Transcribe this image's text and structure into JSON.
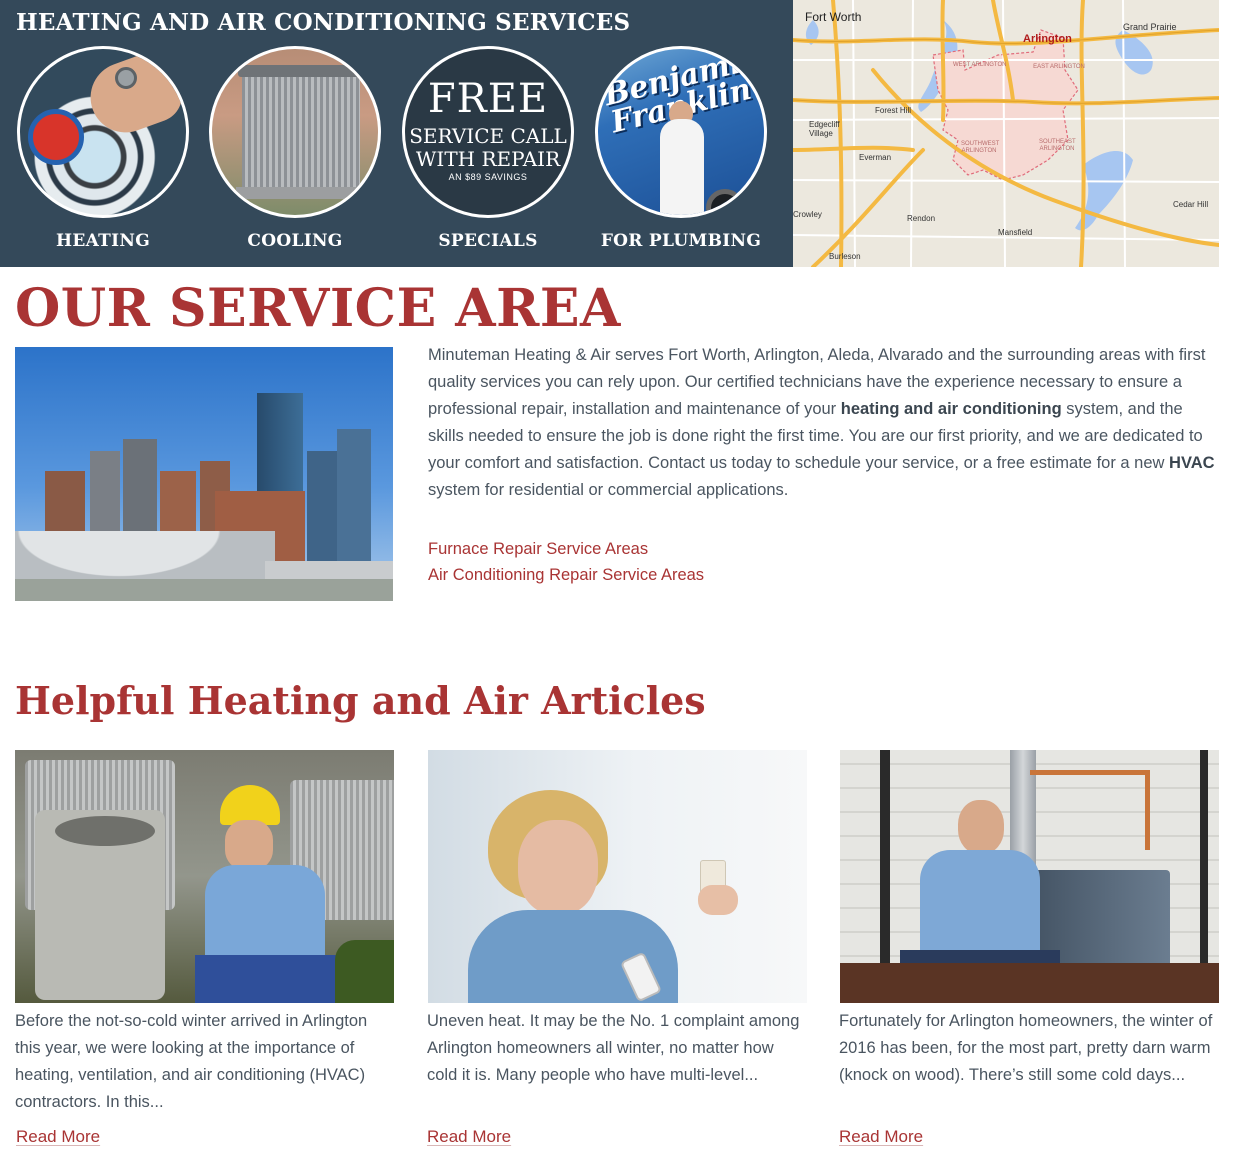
{
  "banner": {
    "title": "HEATING AND AIR CONDITIONING SERVICES",
    "services": [
      {
        "label": "HEATING"
      },
      {
        "label": "COOLING"
      },
      {
        "label": "SPECIALS"
      },
      {
        "label": "FOR PLUMBING"
      }
    ],
    "specials_badge": {
      "free": "FREE",
      "line1": "SERVICE CALL",
      "line2": "WITH REPAIR",
      "savings": "AN $89 SAVINGS"
    },
    "plumbing_brand": "Benjamin Franklin"
  },
  "map": {
    "labels": {
      "fort_worth": "Fort Worth",
      "arlington": "Arlington",
      "grand_prairie": "Grand Prairie",
      "forest_hill": "Forest Hill",
      "edgecliff": "Edgecliff Village",
      "everman": "Everman",
      "rendon": "Rendon",
      "mansfield": "Mansfield",
      "crowley": "Crowley",
      "burleson": "Burleson",
      "cedar_hill": "Cedar Hill",
      "west_arlington": "WEST ARLINGTON",
      "east_arlington": "EAST ARLINGTON",
      "southwest_arlington": "SOUTHWEST ARLINGTON",
      "southeast_arlington": "SOUTHEAST ARLINGTON"
    },
    "colors": {
      "highway": "#f4b942",
      "road": "#ffffff",
      "water": "#a7c6f1",
      "boundary": "#e06b7a",
      "area_fill": "#f6d9d3"
    }
  },
  "service_area": {
    "heading": "OUR SERVICE AREA",
    "paragraph_part1": "Minuteman Heating & Air serves Fort Worth, Arlington, Aleda, Alvarado and the surrounding areas with first quality services you can rely upon. Our certified technicians have the experience necessary to ensure a professional repair, installation and maintenance of your ",
    "paragraph_bold1": "heating and air conditioning",
    "paragraph_part2": " system, and the skills needed to ensure the job is done right the first time. You are our first priority, and we are dedicated to your comfort and satisfaction. Contact us today to schedule your service, or a free estimate for a new ",
    "paragraph_bold2": "HVAC",
    "paragraph_part3": " system for residential or commercial applications.",
    "links": [
      "Furnace Repair Service Areas",
      "Air Conditioning Repair Service Areas"
    ]
  },
  "articles": {
    "heading": "Helpful Heating and Air Articles",
    "items": [
      {
        "excerpt": "Before the not-so-cold winter arrived in Arlington this year, we were looking at the importance of heating, ventilation, and air conditioning (HVAC) contractors. In this...",
        "read_more": "Read More"
      },
      {
        "excerpt": "Uneven heat. It may be the No. 1 complaint among Arlington homeowners all winter, no matter how cold it is. Many people who have multi-level...",
        "read_more": "Read More"
      },
      {
        "excerpt": "Fortunately for Arlington homeowners, the winter of 2016 has been, for the most part, pretty darn warm (knock on wood). There’s still some cold days...",
        "read_more": "Read More"
      }
    ]
  },
  "colors": {
    "banner_bg": "#34495a",
    "accent_red": "#a93434",
    "body_text": "#4a5560"
  }
}
